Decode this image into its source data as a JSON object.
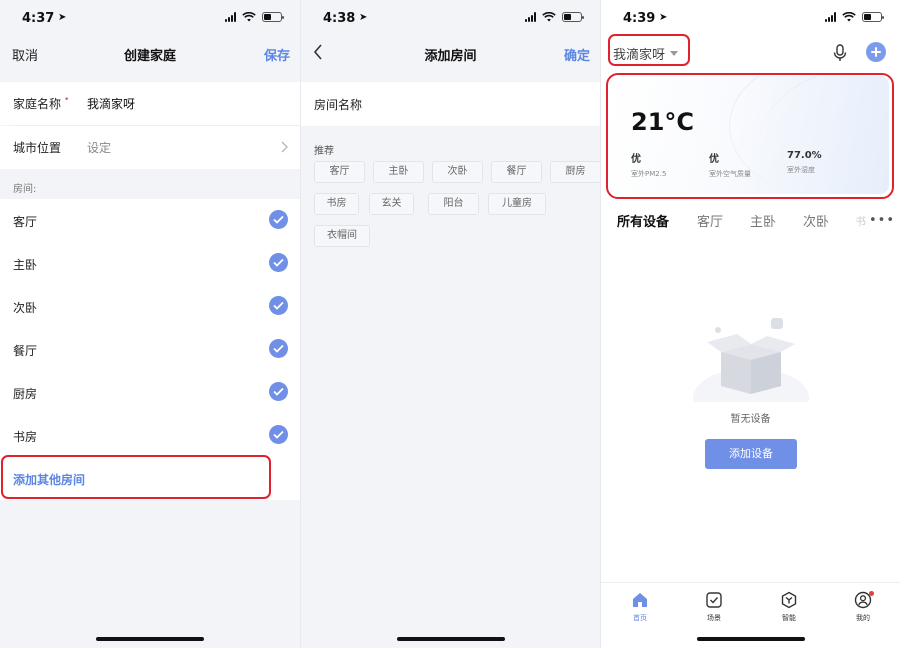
{
  "screens": [
    {
      "status": {
        "time": "4:37"
      },
      "nav": {
        "left": "取消",
        "title": "创建家庭",
        "right": "保存"
      },
      "form": {
        "family_name_label": "家庭名称",
        "required_mark": "•",
        "family_name_value": "我滴家呀",
        "city_label": "城市位置",
        "city_value": "设定"
      },
      "rooms_section_label": "房间:",
      "rooms": [
        "客厅",
        "主卧",
        "次卧",
        "餐厅",
        "厨房",
        "书房"
      ],
      "add_other": "添加其他房间"
    },
    {
      "status": {
        "time": "4:38"
      },
      "nav": {
        "title": "添加房间",
        "right": "确定"
      },
      "room_name_label": "房间名称",
      "recommend_label": "推荐",
      "chips": [
        "客厅",
        "主卧",
        "次卧",
        "餐厅",
        "厨房",
        "书房",
        "玄关",
        "阳台",
        "儿童房",
        "衣帽间"
      ]
    },
    {
      "status": {
        "time": "4:39"
      },
      "home_name": "我滴家呀",
      "weather": {
        "temperature": "21°C",
        "pm25_value": "优",
        "pm25_label": "室外PM2.5",
        "air_value": "优",
        "air_label": "室外空气质量",
        "humidity_value": "77.0%",
        "humidity_label": "室外湿度"
      },
      "tabs": [
        "所有设备",
        "客厅",
        "主卧",
        "次卧"
      ],
      "tab_overflow": "书",
      "more": "•••",
      "empty_text": "暂无设备",
      "add_device": "添加设备",
      "tabbar": [
        "首页",
        "场景",
        "智能",
        "我的"
      ]
    }
  ],
  "colors": {
    "accent": "#5b86e5",
    "highlight": "#e0212e",
    "page_bg": "#f3f4f8"
  },
  "icons": [
    "location-arrow-icon",
    "signal-icon",
    "wifi-icon",
    "battery-icon",
    "back-chevron-icon",
    "chevron-right-icon",
    "check-icon",
    "mic-icon",
    "plus-icon",
    "empty-box-icon",
    "home-icon",
    "scene-icon",
    "smart-icon",
    "profile-icon"
  ]
}
